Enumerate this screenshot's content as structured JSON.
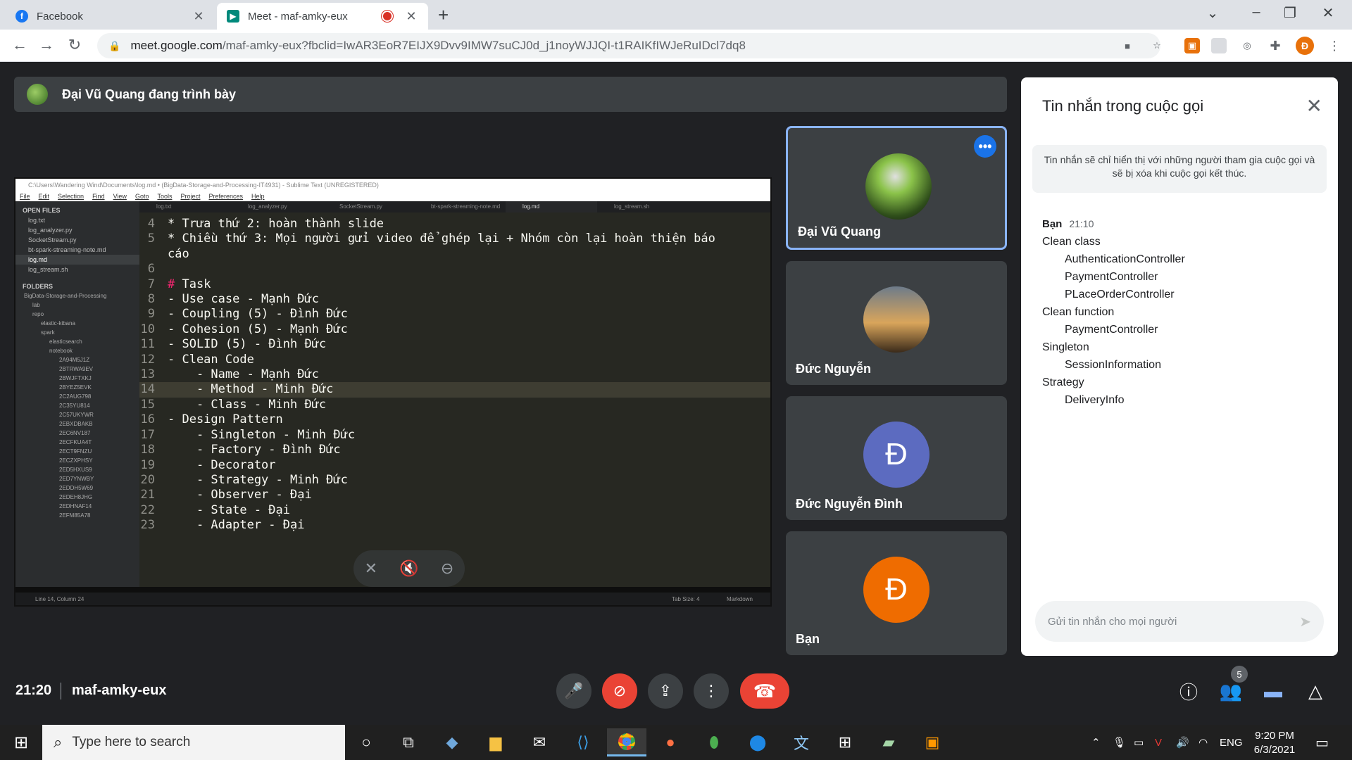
{
  "browser": {
    "tabs": [
      {
        "label": "Facebook",
        "icon": "facebook-icon",
        "color": "#1877f2"
      },
      {
        "label": "Meet - maf-amky-eux",
        "icon": "meet-icon",
        "color": "#00897b"
      }
    ],
    "url_domain": "meet.google.com",
    "url_rest": "/maf-amky-eux?fbclid=IwAR3EoR7EIJX9Dvv9IMW7suCJ0d_j1noyWJJQI-t1RAIKfIWJeRuIDcl7dq8",
    "profile_initial": "Đ"
  },
  "meet": {
    "presenting_text": "Đại Vũ Quang đang trình bày",
    "participants": [
      {
        "name": "Đại Vũ Quang",
        "avatar": "photo-plant",
        "active": true
      },
      {
        "name": "Đức Nguyễn",
        "avatar": "photo-sunset"
      },
      {
        "name": "Đức Nguyễn Đình",
        "avatar_letter": "Đ",
        "avatar_color": "#5c6bc0"
      },
      {
        "name": "Bạn",
        "avatar_letter": "Đ",
        "avatar_color": "#ef6c00"
      }
    ],
    "clock": "21:20",
    "meeting_code": "maf-amky-eux",
    "participant_count": "5"
  },
  "sublime": {
    "title": "C:\\Users\\Wandering Wind\\Documents\\log.md • (BigData-Storage-and-Processing-IT4931) - Sublime Text (UNREGISTERED)",
    "menu": [
      "File",
      "Edit",
      "Selection",
      "Find",
      "View",
      "Goto",
      "Tools",
      "Project",
      "Preferences",
      "Help"
    ],
    "open_files_header": "OPEN FILES",
    "open_files": [
      "log.txt",
      "log_analyzer.py",
      "SocketStream.py",
      "bt-spark-streaming-note.md",
      "log.md",
      "log_stream.sh"
    ],
    "folders_header": "FOLDERS",
    "folders": [
      "BigData-Storage-and-Processing",
      "lab",
      "repo",
      "elastic-kibana",
      "spark",
      "elasticsearch",
      "notebook",
      "2A94M5J1Z",
      "2BTRWA9EV",
      "2BWJFTXKJ",
      "2BYEZ5EVK",
      "2C2AUG798",
      "2C35YU814",
      "2C57UKYWR",
      "2EBXDBAKB",
      "2EC6NV187",
      "2ECFKUA4T",
      "2ECT9FNZU",
      "2ECZXPHSY",
      "2ED5HXUS9",
      "2ED7YNWBY",
      "2EDDH5W69",
      "2EDEH8JHG",
      "2EDHNAF14",
      "2EFM85A78"
    ],
    "tabs": [
      "log.txt",
      "log_analyzer.py",
      "SocketStream.py",
      "bt-spark-streaming-note.md",
      "log.md",
      "log_stream.sh"
    ],
    "code": [
      {
        "n": "4",
        "t": "* Trưa thứ 2: hoàn thành slide"
      },
      {
        "n": "5",
        "t": "* Chiều thứ 3: Mọi người gửi video để ghép lại + Nhóm còn lại hoàn thiện báo"
      },
      {
        "n": "",
        "t": "cáo"
      },
      {
        "n": "6",
        "t": ""
      },
      {
        "n": "7",
        "t": "# Task"
      },
      {
        "n": "8",
        "t": "- Use case - Mạnh Đức"
      },
      {
        "n": "9",
        "t": "- Coupling (5) - Đình Đức"
      },
      {
        "n": "10",
        "t": "- Cohesion (5) - Mạnh Đức"
      },
      {
        "n": "11",
        "t": "- SOLID (5) - Đình Đức"
      },
      {
        "n": "12",
        "t": "- Clean Code"
      },
      {
        "n": "13",
        "t": "    - Name - Mạnh Đức"
      },
      {
        "n": "14",
        "t": "    - Method - Minh Đức"
      },
      {
        "n": "15",
        "t": "    - Class - Minh Đức"
      },
      {
        "n": "16",
        "t": "- Design Pattern"
      },
      {
        "n": "17",
        "t": "    - Singleton - Minh Đức"
      },
      {
        "n": "18",
        "t": "    - Factory - Đình Đức"
      },
      {
        "n": "19",
        "t": "    - Decorator"
      },
      {
        "n": "20",
        "t": "    - Strategy - Minh Đức"
      },
      {
        "n": "21",
        "t": "    - Observer - Đại"
      },
      {
        "n": "22",
        "t": "    - State - Đại"
      },
      {
        "n": "23",
        "t": "    - Adapter - Đại"
      }
    ],
    "status_left": "Line 14, Column 24",
    "status_tab": "Tab Size: 4",
    "status_syntax": "Markdown"
  },
  "chat": {
    "title": "Tin nhắn trong cuộc gọi",
    "info": "Tin nhắn sẽ chỉ hiển thị với những người tham gia cuộc gọi và sẽ bị xóa khi cuộc gọi kết thúc.",
    "sender": "Bạn",
    "time": "21:10",
    "lines": [
      {
        "text": "Clean class",
        "indent": false
      },
      {
        "text": "AuthenticationController",
        "indent": true
      },
      {
        "text": "PaymentController",
        "indent": true
      },
      {
        "text": "PLaceOrderController",
        "indent": true
      },
      {
        "text": "Clean function",
        "indent": false
      },
      {
        "text": "PaymentController",
        "indent": true
      },
      {
        "text": "Singleton",
        "indent": false
      },
      {
        "text": "SessionInformation",
        "indent": true
      },
      {
        "text": "Strategy",
        "indent": false
      },
      {
        "text": "DeliveryInfo",
        "indent": true
      }
    ],
    "input_placeholder": "Gửi tin nhắn cho mọi người"
  },
  "taskbar": {
    "search_placeholder": "Type here to search",
    "language": "ENG",
    "time": "9:20 PM",
    "date": "6/3/2021"
  },
  "colors": {
    "meet_bg": "#202124",
    "tile_bg": "#3c4043",
    "accent_blue": "#8ab4f8",
    "end_call_red": "#ea4335"
  }
}
